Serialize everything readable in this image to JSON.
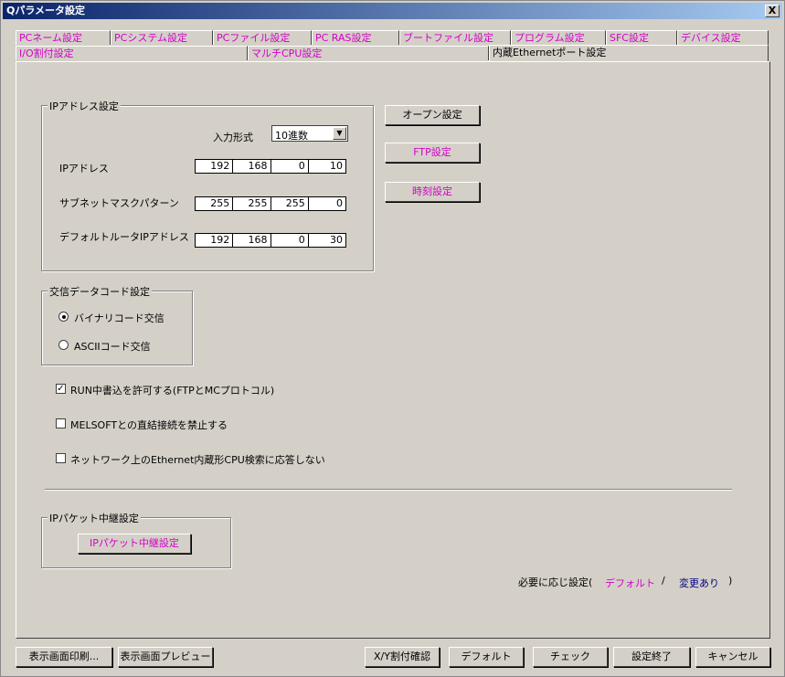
{
  "window": {
    "title": "Qパラメータ設定",
    "close_label": "X"
  },
  "tabs_row1": [
    "PCネーム設定",
    "PCシステム設定",
    "PCファイル設定",
    "PC RAS設定",
    "ブートファイル設定",
    "プログラム設定",
    "SFC設定",
    "デバイス設定"
  ],
  "tabs_row2": [
    "I/O割付設定",
    "マルチCPU設定",
    "内蔵Ethernetポート設定"
  ],
  "ip_group": {
    "title": "IPアドレス設定",
    "input_format_label": "入力形式",
    "input_format_value": "10進数",
    "ip_label": "IPアドレス",
    "ip": [
      "192",
      "168",
      "0",
      "10"
    ],
    "subnet_label": "サブネットマスクパターン",
    "subnet": [
      "255",
      "255",
      "255",
      "0"
    ],
    "gateway_label": "デフォルトルータIPアドレス",
    "gateway": [
      "192",
      "168",
      "0",
      "30"
    ]
  },
  "side_buttons": {
    "open": "オープン設定",
    "ftp": "FTP設定",
    "time": "時刻設定"
  },
  "comm_group": {
    "title": "交信データコード設定",
    "binary": "バイナリコード交信",
    "ascii": "ASCIIコード交信"
  },
  "checks": {
    "run_write": "RUN中書込を許可する(FTPとMCプロトコル)",
    "melsoft": "MELSOFTとの直結接続を禁止する",
    "network": "ネットワーク上のEthernet内蔵形CPU検索に応答しない"
  },
  "relay_group": {
    "title": "IPパケット中継設定",
    "button": "IPパケット中継設定"
  },
  "legend": {
    "prefix": "必要に応じ設定(",
    "default": "デフォルト",
    "slash": "/",
    "changed": "変更あり",
    "suffix": ")"
  },
  "bottom_buttons": {
    "print": "表示画面印刷...",
    "preview": "表示画面プレビュー",
    "xy": "X/Y割付確認",
    "default": "デフォルト",
    "check": "チェック",
    "finish": "設定終了",
    "cancel": "キャンセル"
  },
  "colors": {
    "accent": "#d400c8",
    "changed": "#000080"
  }
}
